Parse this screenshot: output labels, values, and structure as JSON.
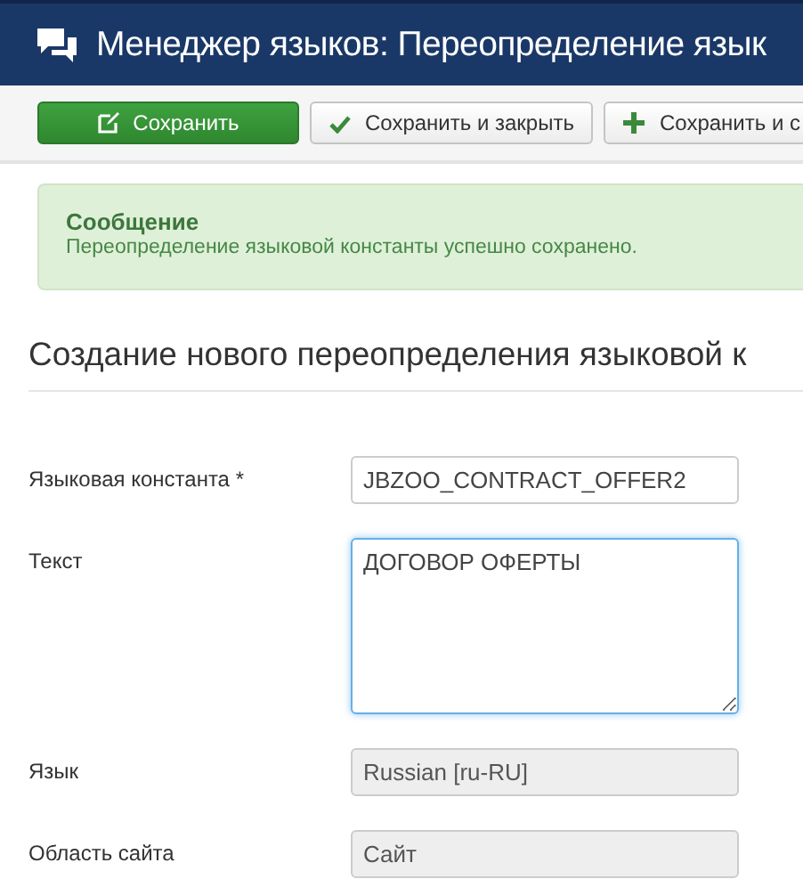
{
  "header": {
    "title": "Менеджер языков: Переопределение язык"
  },
  "toolbar": [
    {
      "label": "Сохранить",
      "kind": "primary"
    },
    {
      "label": "Сохранить и закрыть",
      "kind": "close"
    },
    {
      "label": "Сохранить и с",
      "kind": "new"
    }
  ],
  "message": {
    "heading": "Сообщение",
    "text": "Переопределение языковой константы успешно сохранено."
  },
  "form": {
    "heading": "Создание нового переопределения языковой к",
    "fields": [
      {
        "label": "Языковая константа *",
        "kind": "text",
        "value": "JBZOO_CONTRACT_OFFER2",
        "disabled": false,
        "focused": false
      },
      {
        "label": "Текст",
        "kind": "textarea",
        "value": "ДОГОВОР ОФЕРТЫ",
        "disabled": false,
        "focused": true
      },
      {
        "label": "Язык",
        "kind": "text",
        "value": "Russian [ru-RU]",
        "disabled": true,
        "focused": false
      },
      {
        "label": "Область сайта",
        "kind": "text",
        "value": "Сайт",
        "disabled": true,
        "focused": false
      }
    ]
  }
}
